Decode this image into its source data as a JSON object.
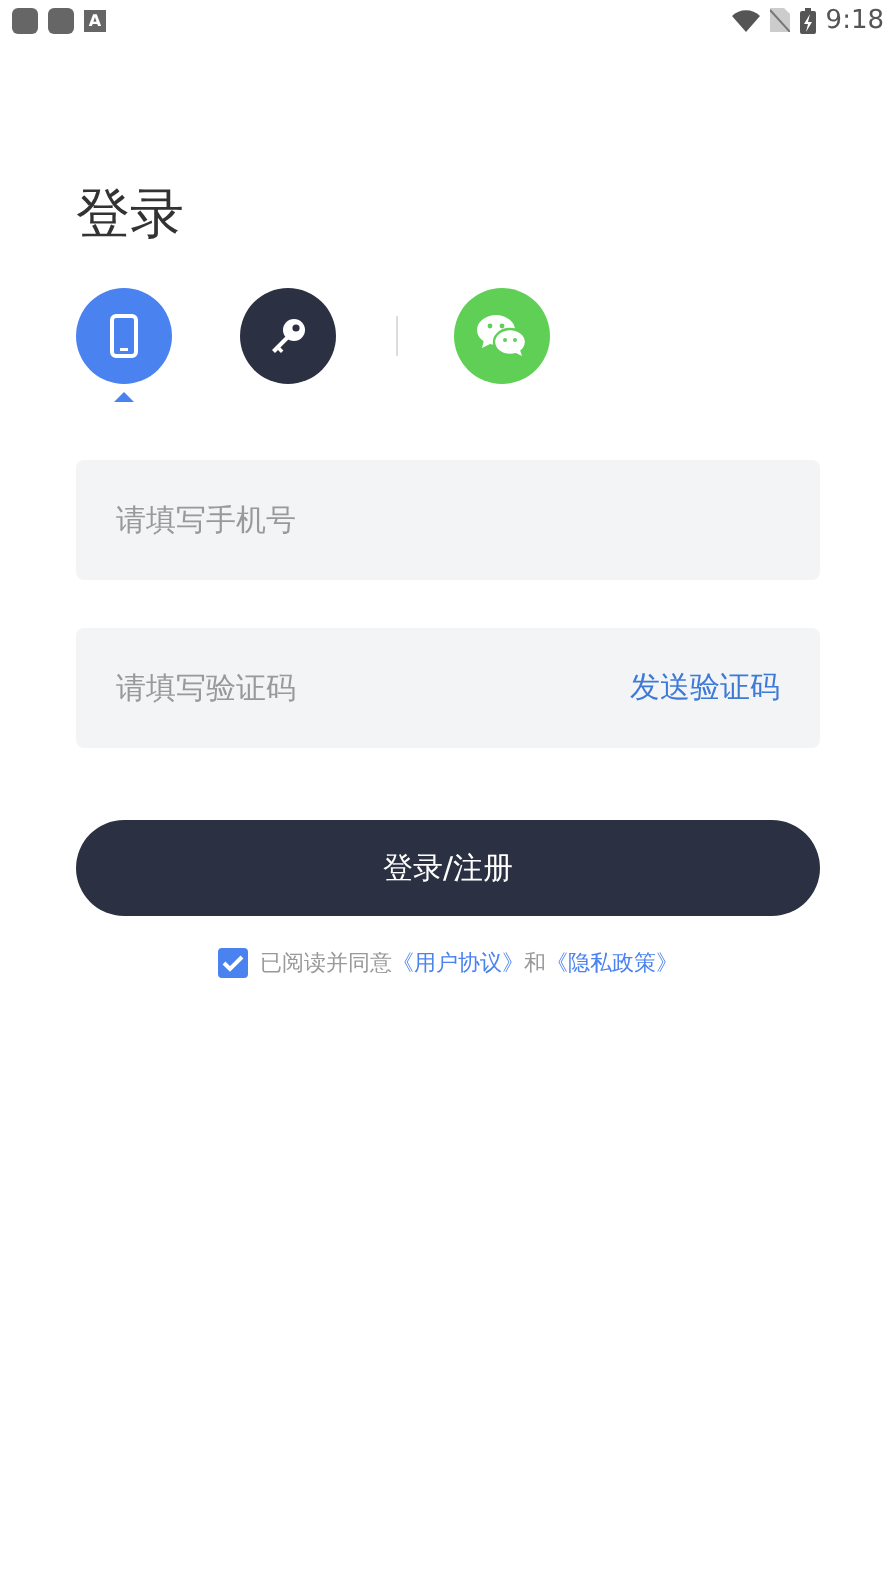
{
  "status_bar": {
    "notification_letter": "A",
    "time": "9:18"
  },
  "title": "登录",
  "login_methods": [
    {
      "kind": "phone",
      "color": "#4a82f0",
      "selected": true
    },
    {
      "kind": "key",
      "color": "#2b3142",
      "selected": false
    },
    {
      "kind": "wechat",
      "color": "#5fcf55",
      "selected": false
    }
  ],
  "phone_field": {
    "placeholder": "请填写手机号"
  },
  "code_field": {
    "placeholder": "请填写验证码",
    "action": "发送验证码"
  },
  "submit_button": "登录/注册",
  "agreement": {
    "checked": true,
    "text": "已阅读并同意",
    "link_1": "《用户协议》",
    "conjunction": "和",
    "link_2": "《隐私政策》"
  }
}
